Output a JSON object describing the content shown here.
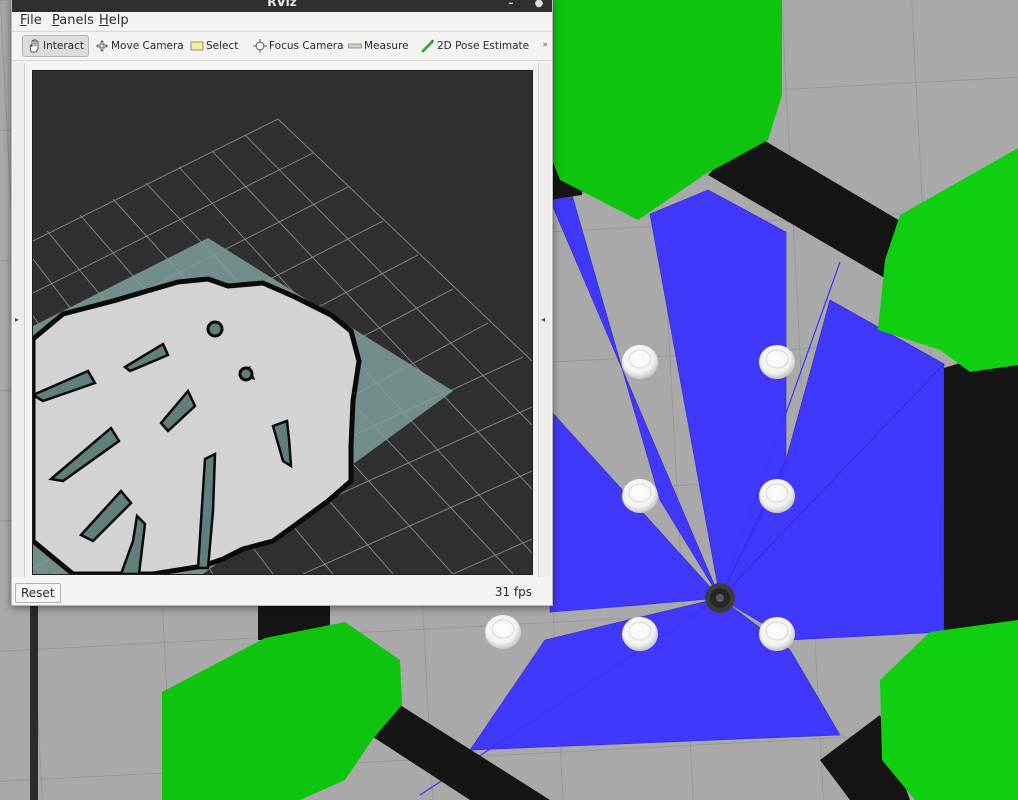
{
  "window": {
    "title": "RViz"
  },
  "menubar": [
    {
      "mnemonic": "F",
      "rest": "ile"
    },
    {
      "mnemonic": "P",
      "rest": "anels"
    },
    {
      "mnemonic": "H",
      "rest": "elp"
    }
  ],
  "toolbar": {
    "tools": [
      {
        "label": "Interact",
        "icon": "hand-icon",
        "active": true
      },
      {
        "label": "Move Camera",
        "icon": "move-camera-icon",
        "active": false
      },
      {
        "label": "Select",
        "icon": "select-icon",
        "active": false
      },
      {
        "label": "Focus Camera",
        "icon": "focus-camera-icon",
        "active": false
      },
      {
        "label": "Measure",
        "icon": "measure-icon",
        "active": false
      },
      {
        "label": "2D Pose Estimate",
        "icon": "pose-estimate-icon",
        "active": false
      }
    ],
    "overflow": "»"
  },
  "statusbar": {
    "reset_label": "Reset",
    "fps": "31 fps"
  },
  "colors": {
    "floor": "#a9a9a9",
    "pillar_green": "#0fc40f",
    "wall": "#151515",
    "laser": "#3a33ff",
    "map_free": "#d3d3d3",
    "map_unknown": "#7f9f9a",
    "viewport_bg": "#303030"
  }
}
